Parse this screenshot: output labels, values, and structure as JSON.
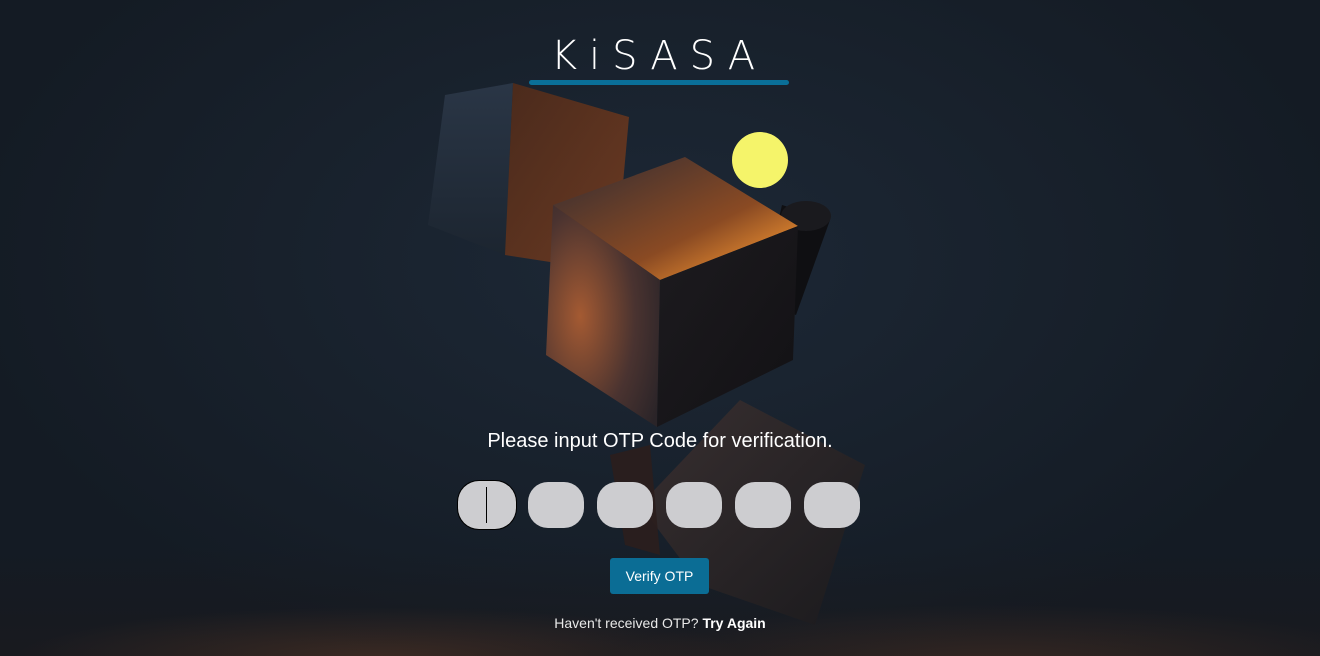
{
  "brand": {
    "logo_text": "KiSASA",
    "accent_color": "#0a6f98"
  },
  "otp": {
    "prompt": "Please input OTP Code for verification.",
    "digits": [
      "",
      "",
      "",
      "",
      "",
      ""
    ],
    "focused_index": 0
  },
  "actions": {
    "verify_label": "Verify OTP",
    "resend_question": "Haven't received OTP?",
    "resend_link": "Try Again"
  },
  "colors": {
    "background": "#18212c",
    "button": "#0b6d95",
    "input_fill": "#cdcdd0",
    "sun": "#f5f46a",
    "cube_glow": "#e8852e"
  }
}
